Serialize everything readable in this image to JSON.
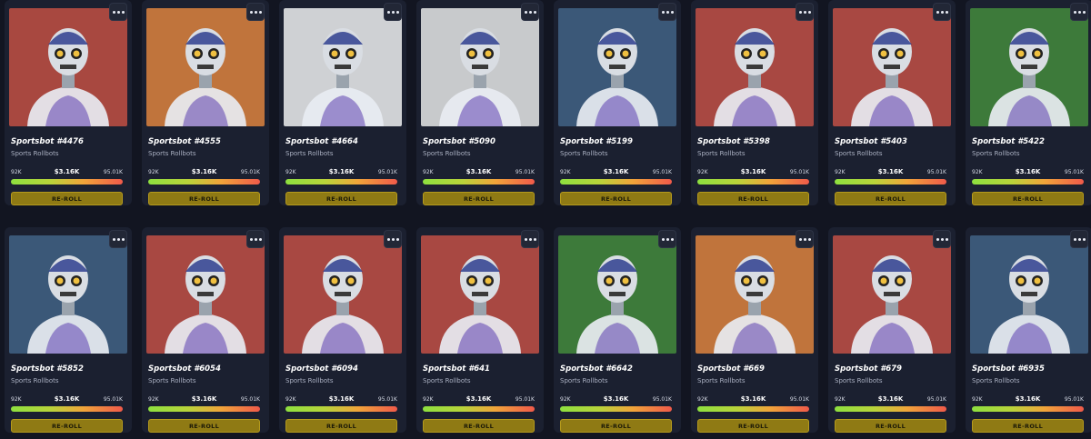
{
  "common": {
    "collection": "Sports Rollbots",
    "price_low": "92K",
    "price_mid": "$3.16K",
    "price_high": "95.01K",
    "reroll_label": "RE-ROLL",
    "menu_icon": "more-dots-icon"
  },
  "cards": [
    {
      "name": "Sportsbot #4476",
      "bg": "#a84840"
    },
    {
      "name": "Sportsbot #4555",
      "bg": "#c0743c"
    },
    {
      "name": "Sportsbot #4664",
      "bg": "#cfd1d4"
    },
    {
      "name": "Sportsbot #5090",
      "bg": "#c8cacc"
    },
    {
      "name": "Sportsbot #5199",
      "bg": "#3b5878"
    },
    {
      "name": "Sportsbot #5398",
      "bg": "#a84842"
    },
    {
      "name": "Sportsbot #5403",
      "bg": "#a84842"
    },
    {
      "name": "Sportsbot #5422",
      "bg": "#3d7a3a"
    },
    {
      "name": "Sportsbot #5852",
      "bg": "#3b5878"
    },
    {
      "name": "Sportsbot #6054",
      "bg": "#a84842"
    },
    {
      "name": "Sportsbot #6094",
      "bg": "#a84842"
    },
    {
      "name": "Sportsbot #641",
      "bg": "#a84842"
    },
    {
      "name": "Sportsbot #6642",
      "bg": "#3d7a3a"
    },
    {
      "name": "Sportsbot #669",
      "bg": "#c0743c"
    },
    {
      "name": "Sportsbot #679",
      "bg": "#a84842"
    },
    {
      "name": "Sportsbot #6935",
      "bg": "#3b5878"
    }
  ]
}
